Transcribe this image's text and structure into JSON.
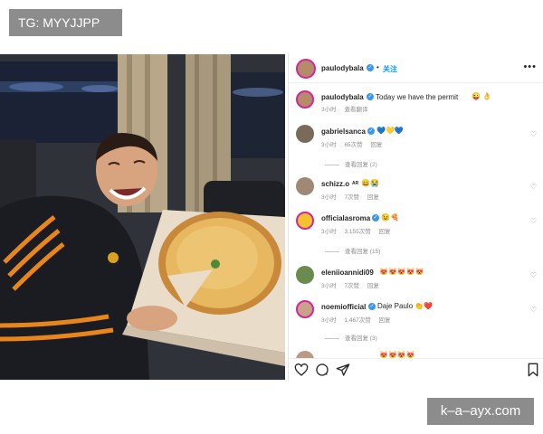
{
  "watermarks": {
    "top_left": "TG: MYYJJPP",
    "bottom_right": "k–a–ayx.com"
  },
  "post": {
    "username": "paulodybala",
    "follow_label": "关注",
    "caption_user": "paulodybala",
    "caption_text": "Today we have the permit",
    "caption_emoji": "😜 👌",
    "caption_time": "3小时",
    "caption_translate": "查看翻译"
  },
  "comments": [
    {
      "user": "gabrielsanca",
      "text": "💙💛💙",
      "time": "3小时",
      "likes": "65次赞",
      "reply": "回复",
      "view_replies": "查看回复 (2)"
    },
    {
      "user": "schizz.o",
      "tag": "AR",
      "text": "😄😭",
      "time": "3小时",
      "likes": "7次赞",
      "reply": "回复",
      "view_replies": ""
    },
    {
      "user": "officialasroma",
      "text": "😉🍕",
      "time": "3小时",
      "likes": "3,155次赞",
      "reply": "回复",
      "view_replies": "查看回复 (15)"
    },
    {
      "user": "eleniioannidi09",
      "text": "😻😻😻😻😻",
      "time": "3小时",
      "likes": "7次赞",
      "reply": "回复",
      "view_replies": ""
    },
    {
      "user": "noemiofficial",
      "text": "Daje Paulo 👏❤️",
      "time": "3小时",
      "likes": "1,467次赞",
      "reply": "回复",
      "view_replies": "查看回复 (3)"
    },
    {
      "user": "",
      "text": "😻😻😻😻",
      "time": "",
      "likes": "",
      "reply": "",
      "view_replies": ""
    }
  ],
  "icons": {
    "like": "heart-icon",
    "comment": "comment-icon",
    "share": "share-icon",
    "save": "bookmark-icon",
    "more": "more-icon"
  },
  "colors": {
    "link_blue": "#0095f6",
    "verified_blue": "#3897f0",
    "watermark_gray": "#8c8c8c"
  }
}
